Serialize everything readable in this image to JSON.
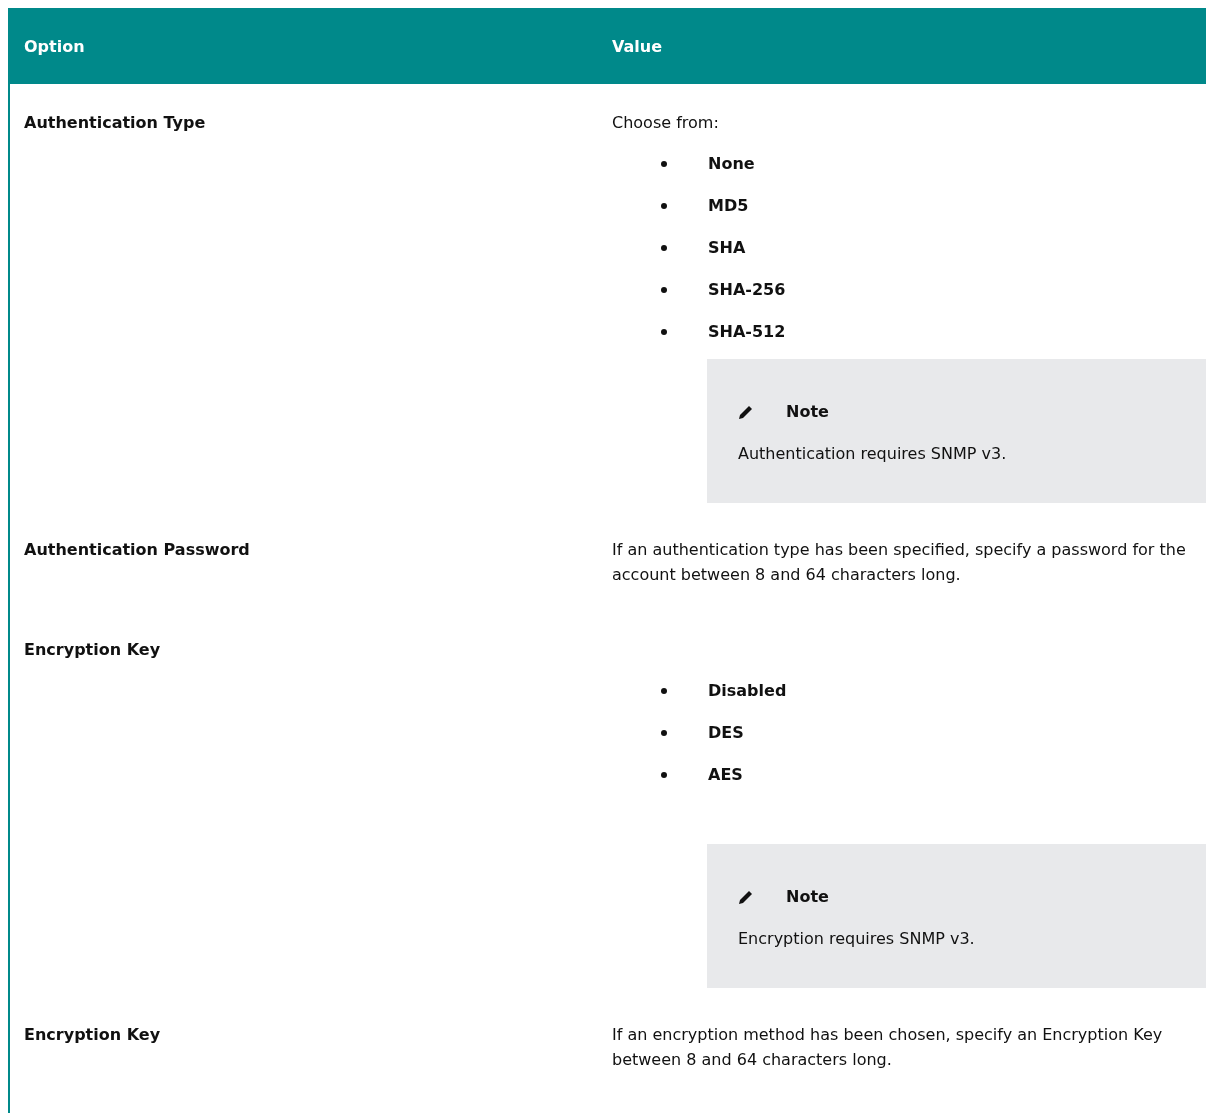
{
  "table": {
    "columns": [
      "Option",
      "Value"
    ],
    "rows": [
      {
        "option": "Authentication Type",
        "value": {
          "intro": "Choose from:",
          "items": [
            "None",
            "MD5",
            "SHA",
            "SHA-256",
            "SHA-512"
          ],
          "note": {
            "title": "Note",
            "text": "Authentication requires SNMP v3."
          }
        }
      },
      {
        "option": "Authentication Password",
        "value": {
          "text": "If an authentication type has been specified, specify a password for the account between 8 and 64 characters long."
        }
      },
      {
        "option": "Encryption Key",
        "value": {
          "items": [
            "Disabled",
            "DES",
            "AES"
          ],
          "note": {
            "title": "Note",
            "text": "Encryption requires SNMP v3."
          }
        }
      },
      {
        "option": "Encryption Key",
        "value": {
          "text": "If an encryption method has been chosen, specify an Encryption Key between 8 and 64 characters long."
        }
      }
    ]
  }
}
